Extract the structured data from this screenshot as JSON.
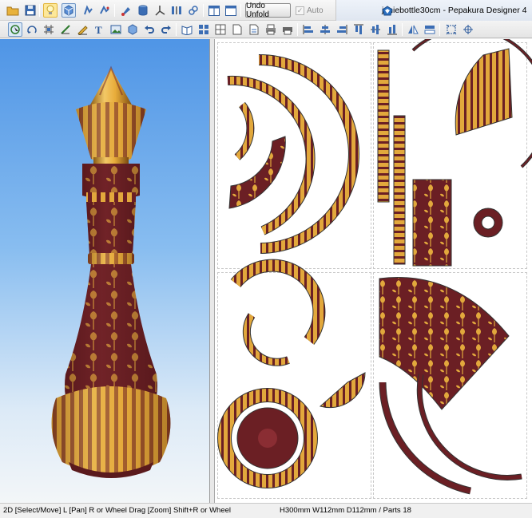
{
  "window": {
    "document_name": "jeniebottle30cm",
    "app_name": "Pepakura Designer 4",
    "title_full": "jeniebottle30cm - Pepakura Designer 4"
  },
  "toolbar": {
    "undo_unfold_label": "Undo Unfold",
    "auto_label": "Auto",
    "auto_checked": true,
    "auto_enabled": false,
    "row1_icons": [
      "open-folder-icon",
      "save-icon",
      "lightbulb-icon",
      "3d-box-icon",
      "figure-icon",
      "figure-alt-icon",
      "paint-icon",
      "cylinder-icon",
      "axis-icon",
      "split-bars-icon",
      "link-chain-icon",
      "split-view-icon",
      "single-view-icon"
    ],
    "row2_icons": [
      "select-icon",
      "rotate-icon",
      "grid-icon",
      "edge-icon",
      "draw-line-icon",
      "text-icon",
      "image-icon",
      "fold-icon",
      "undo-icon",
      "redo-icon",
      "book-icon",
      "pages-icon",
      "tile-icon",
      "page-icon",
      "page-setup-icon",
      "print-icon",
      "print-alt-icon",
      "align-left-icon",
      "align-center-icon",
      "align-right-icon",
      "align-top-icon",
      "align-middle-icon",
      "align-bottom-icon",
      "flip-h-icon",
      "flip-v-icon",
      "fit-icon",
      "grid-fit-icon"
    ]
  },
  "status": {
    "mode_text": "2D [Select/Move] L [Pan] R or Wheel Drag [Zoom] Shift+R or Wheel",
    "dimensions_text": "H300mm W112mm D112mm / Parts 18"
  },
  "colors": {
    "maroon": "#6b1f24",
    "gold": "#e2a83c",
    "gold_light": "#f0c565",
    "sky_top": "#4f95e6",
    "sky_bottom": "#f3f6f8"
  }
}
